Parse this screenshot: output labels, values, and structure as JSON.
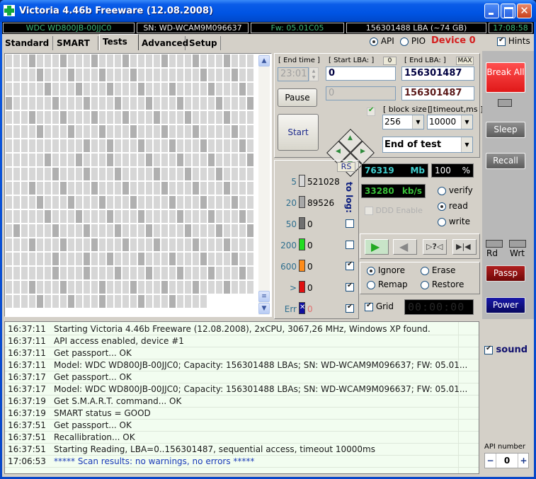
{
  "window": {
    "title": "Victoria 4.46b Freeware (12.08.2008)",
    "app_icon": "green-cross-icon",
    "controls": {
      "minimize": "_",
      "maximize": "□",
      "close": "✕"
    }
  },
  "infobar": {
    "model": "WDC WD800JB-00JJC0",
    "serial": "SN: WD-WCAM9M096637",
    "firmware": "Fw: 05.01C05",
    "capacity": "156301488 LBA (~74 GB)",
    "clock": "17:08:58"
  },
  "tabs": [
    {
      "label": "Standard",
      "active": false
    },
    {
      "label": "SMART",
      "active": false
    },
    {
      "label": "Tests",
      "active": true
    },
    {
      "label": "Advanced",
      "active": false
    },
    {
      "label": "Setup",
      "active": false
    }
  ],
  "mode": {
    "api_label": "API",
    "api_selected": true,
    "pio_label": "PIO",
    "pio_selected": false,
    "device_label": "Device 0",
    "hints_label": "Hints",
    "hints_checked": true
  },
  "grid": {
    "columns": 32,
    "rows": 18,
    "last_row_filled": 26,
    "legend_meaning": "block read time map",
    "marked_cells": [
      [
        0,
        3
      ],
      [
        0,
        7
      ],
      [
        0,
        11
      ],
      [
        0,
        15
      ],
      [
        0,
        20
      ],
      [
        0,
        24
      ],
      [
        0,
        28
      ],
      [
        1,
        4
      ],
      [
        1,
        8
      ],
      [
        1,
        12
      ],
      [
        1,
        16
      ],
      [
        1,
        25
      ],
      [
        1,
        29
      ],
      [
        2,
        5
      ],
      [
        2,
        9
      ],
      [
        2,
        13
      ],
      [
        2,
        17
      ],
      [
        2,
        21
      ],
      [
        2,
        26
      ],
      [
        2,
        30
      ],
      [
        3,
        0
      ],
      [
        3,
        6
      ],
      [
        3,
        10
      ],
      [
        3,
        14
      ],
      [
        3,
        18
      ],
      [
        3,
        22
      ],
      [
        3,
        27
      ],
      [
        3,
        31
      ],
      [
        4,
        3
      ],
      [
        4,
        7
      ],
      [
        4,
        11
      ],
      [
        4,
        15
      ],
      [
        4,
        19
      ],
      [
        4,
        23
      ],
      [
        4,
        28
      ],
      [
        5,
        4
      ],
      [
        5,
        8
      ],
      [
        5,
        12
      ],
      [
        5,
        16
      ],
      [
        5,
        20
      ],
      [
        5,
        24
      ],
      [
        5,
        29
      ],
      [
        6,
        10
      ],
      [
        6,
        13
      ],
      [
        6,
        17
      ],
      [
        6,
        21
      ],
      [
        6,
        25
      ],
      [
        6,
        30
      ],
      [
        7,
        5
      ],
      [
        7,
        9
      ],
      [
        7,
        13
      ],
      [
        7,
        18
      ],
      [
        7,
        22
      ],
      [
        7,
        26
      ],
      [
        7,
        31
      ],
      [
        8,
        6
      ],
      [
        8,
        10
      ],
      [
        8,
        14
      ],
      [
        8,
        19
      ],
      [
        8,
        23
      ],
      [
        8,
        27
      ],
      [
        9,
        3
      ],
      [
        9,
        7
      ],
      [
        9,
        11
      ],
      [
        9,
        15
      ],
      [
        9,
        20
      ],
      [
        9,
        24
      ],
      [
        9,
        28
      ],
      [
        10,
        4
      ],
      [
        10,
        8
      ],
      [
        10,
        12
      ],
      [
        10,
        16
      ],
      [
        10,
        21
      ],
      [
        10,
        25
      ],
      [
        10,
        29
      ],
      [
        11,
        5
      ],
      [
        11,
        9
      ],
      [
        11,
        13
      ],
      [
        11,
        17
      ],
      [
        11,
        22
      ],
      [
        11,
        26
      ],
      [
        11,
        30
      ],
      [
        12,
        1
      ],
      [
        12,
        6
      ],
      [
        12,
        10
      ],
      [
        12,
        14
      ],
      [
        12,
        18
      ],
      [
        12,
        23
      ],
      [
        12,
        27
      ],
      [
        12,
        31
      ],
      [
        13,
        3
      ],
      [
        13,
        7
      ],
      [
        13,
        11
      ],
      [
        13,
        15
      ],
      [
        13,
        19
      ],
      [
        13,
        24
      ],
      [
        13,
        28
      ],
      [
        14,
        6
      ],
      [
        14,
        10
      ],
      [
        14,
        13
      ],
      [
        14,
        17
      ],
      [
        14,
        21
      ],
      [
        14,
        25
      ],
      [
        14,
        29
      ],
      [
        15,
        6
      ],
      [
        15,
        10
      ],
      [
        15,
        14
      ],
      [
        15,
        18
      ],
      [
        15,
        22
      ],
      [
        15,
        26
      ],
      [
        15,
        30
      ],
      [
        16,
        3
      ],
      [
        16,
        7
      ],
      [
        16,
        12
      ],
      [
        16,
        16
      ],
      [
        16,
        20
      ],
      [
        16,
        24
      ],
      [
        16,
        28
      ],
      [
        17,
        4
      ],
      [
        17,
        8
      ],
      [
        17,
        12
      ],
      [
        17,
        17
      ],
      [
        17,
        21
      ]
    ]
  },
  "range": {
    "end_time_label": "[ End time ]",
    "end_time_value": "23:01",
    "start_lba_label": "[ Start LBA: ]",
    "start_lba_reset": "0",
    "start_lba_value": "0",
    "current_lba_value": "0",
    "end_lba_label": "[ End LBA: ]",
    "end_lba_max": "MAX",
    "end_lba_value": "156301487",
    "end_lba_current": "156301487",
    "pause_label": "Pause",
    "start_label": "Start",
    "block_size_label": "[ block size ]",
    "block_size_value": "256",
    "timeout_label": "[ timeout,ms ]",
    "timeout_value": "10000",
    "end_action_value": "End of test"
  },
  "stats": {
    "rs_label": "RS",
    "to_log_label": "to log:",
    "rows": [
      {
        "threshold": "5",
        "count": "521028",
        "color": "#d8d8d8",
        "log": null
      },
      {
        "threshold": "20",
        "count": "89526",
        "color": "#a8a8a8",
        "log": null
      },
      {
        "threshold": "50",
        "count": "0",
        "color": "#707070",
        "log": false
      },
      {
        "threshold": "200",
        "count": "0",
        "color": "#22dd22",
        "log": false
      },
      {
        "threshold": "600",
        "count": "0",
        "color": "#ff8c1a",
        "log": true
      },
      {
        "threshold": ">",
        "count": "0",
        "color": "#e01010",
        "log": true
      },
      {
        "threshold": "Err",
        "count": "0",
        "color": "#1010a0",
        "log": true
      }
    ]
  },
  "scan": {
    "megabytes": "76319",
    "megabytes_unit": "Mb",
    "percent": "100",
    "percent_unit": "%",
    "speed": "33280",
    "speed_unit": "kb/s",
    "ddd_label": "DDD Enable",
    "ddd_checked": false,
    "mode_options": [
      {
        "label": "verify",
        "selected": false
      },
      {
        "label": "read",
        "selected": true
      },
      {
        "label": "write",
        "selected": false
      }
    ],
    "playback": [
      {
        "name": "play-forward-button",
        "glyph": "▶",
        "active": true
      },
      {
        "name": "play-backward-button",
        "glyph": "◀",
        "active": false
      },
      {
        "name": "random-seek-button",
        "glyph": "▷?◁",
        "active": false
      },
      {
        "name": "butterfly-button",
        "glyph": "▶|◀",
        "active": false
      }
    ],
    "action_options": [
      {
        "label": "Ignore",
        "selected": true
      },
      {
        "label": "Erase",
        "selected": false
      },
      {
        "label": "Remap",
        "selected": false
      },
      {
        "label": "Restore",
        "selected": false
      }
    ],
    "grid_label": "Grid",
    "grid_checked": true,
    "timer": "00:00:00"
  },
  "sidebar": {
    "break_all": "Break All",
    "sleep": "Sleep",
    "recall": "Recall",
    "rd_label": "Rd",
    "wrt_label": "Wrt",
    "passp": "Passp",
    "power": "Power",
    "sound_label": "sound",
    "sound_checked": true,
    "api_number_label": "API number",
    "api_number_value": "0",
    "minus": "−",
    "plus": "+"
  },
  "log": [
    {
      "time": "16:37:11",
      "message": "Starting Victoria 4.46b Freeware (12.08.2008), 2xCPU, 3067,26 MHz, Windows XP found.",
      "highlight": false
    },
    {
      "time": "16:37:11",
      "message": "API access enabled, device #1",
      "highlight": false
    },
    {
      "time": "16:37:11",
      "message": "Get passport... OK",
      "highlight": false
    },
    {
      "time": "16:37:11",
      "message": "Model: WDC WD800JB-00JJC0; Capacity: 156301488 LBAs; SN: WD-WCAM9M096637; FW: 05.01...",
      "highlight": false
    },
    {
      "time": "16:37:17",
      "message": "Get passport... OK",
      "highlight": false
    },
    {
      "time": "16:37:17",
      "message": "Model: WDC WD800JB-00JJC0; Capacity: 156301488 LBAs; SN: WD-WCAM9M096637; FW: 05.01...",
      "highlight": false
    },
    {
      "time": "16:37:19",
      "message": "Get S.M.A.R.T. command... OK",
      "highlight": false
    },
    {
      "time": "16:37:19",
      "message": "SMART status = GOOD",
      "highlight": false
    },
    {
      "time": "16:37:51",
      "message": "Get passport... OK",
      "highlight": false
    },
    {
      "time": "16:37:51",
      "message": "Recallibration... OK",
      "highlight": false
    },
    {
      "time": "16:37:51",
      "message": "Starting Reading, LBA=0..156301487, sequential access, timeout 10000ms",
      "highlight": false
    },
    {
      "time": "17:06:53",
      "message": "***** Scan results: no warnings, no errors *****",
      "highlight": true
    }
  ]
}
